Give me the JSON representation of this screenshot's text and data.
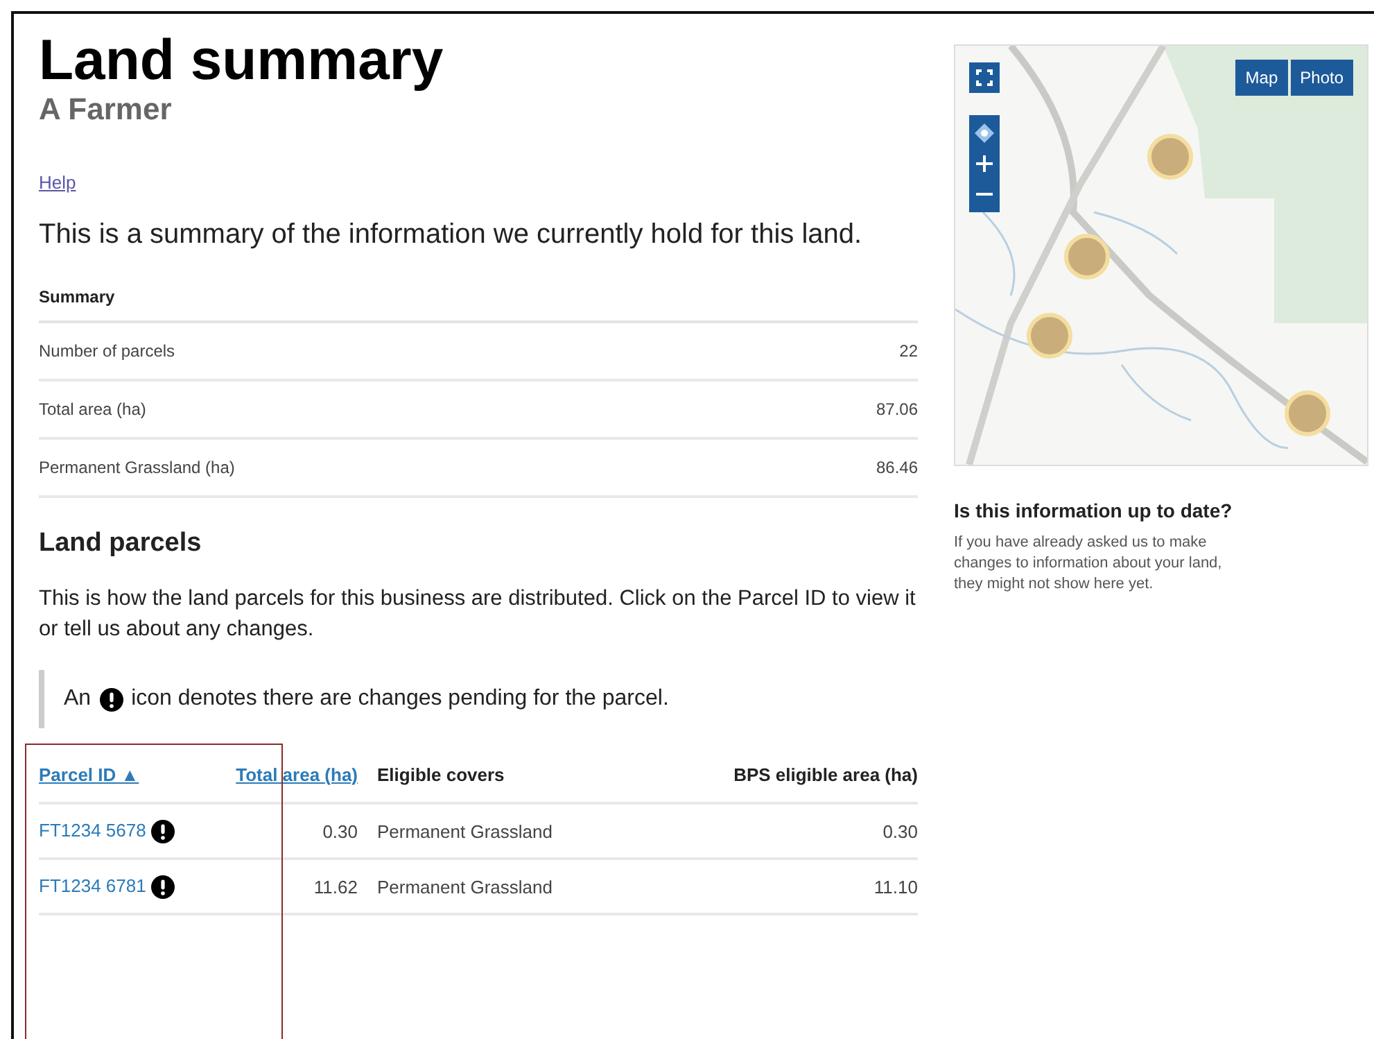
{
  "header": {
    "title": "Land summary",
    "subtitle": "A Farmer"
  },
  "help_link": "Help",
  "intro": "This is a summary of the information we currently hold for this land.",
  "summary": {
    "heading": "Summary",
    "rows": [
      {
        "label": "Number of parcels",
        "value": "22"
      },
      {
        "label": "Total area (ha)",
        "value": "87.06"
      },
      {
        "label": "Permanent Grassland (ha)",
        "value": "86.46"
      }
    ]
  },
  "land_parcels": {
    "heading": "Land parcels",
    "description": "This is how the land parcels for this business are distributed. Click on the Parcel ID to view it or tell us about any changes.",
    "notice": {
      "before": "An",
      "after": "icon denotes there are changes pending for the parcel."
    },
    "table": {
      "columns": [
        {
          "label": "Parcel ID",
          "kind": "link",
          "sort_indicator": "▲"
        },
        {
          "label": "Total area (ha)",
          "kind": "link"
        },
        {
          "label": "Eligible covers",
          "kind": "plain"
        },
        {
          "label": "BPS eligible area (ha)",
          "kind": "plain"
        }
      ],
      "rows": [
        {
          "parcel_id": "FT1234 5678",
          "pending": true,
          "total_area": "0.30",
          "eligible_covers": "Permanent Grassland",
          "bps_area": "0.30"
        },
        {
          "parcel_id": "FT1234 6781",
          "pending": true,
          "total_area": "11.62",
          "eligible_covers": "Permanent Grassland",
          "bps_area": "11.10"
        }
      ]
    }
  },
  "map": {
    "kind": "picture",
    "layers": [
      {
        "label": "Map"
      },
      {
        "label": "Photo"
      }
    ]
  },
  "sidebar": {
    "heading": "Is this information up to date?",
    "text": "If you have already asked us to make changes to information about your land, they might not show here yet."
  },
  "annotation": {
    "kind": "highlight",
    "color": "#8b2a2a"
  }
}
